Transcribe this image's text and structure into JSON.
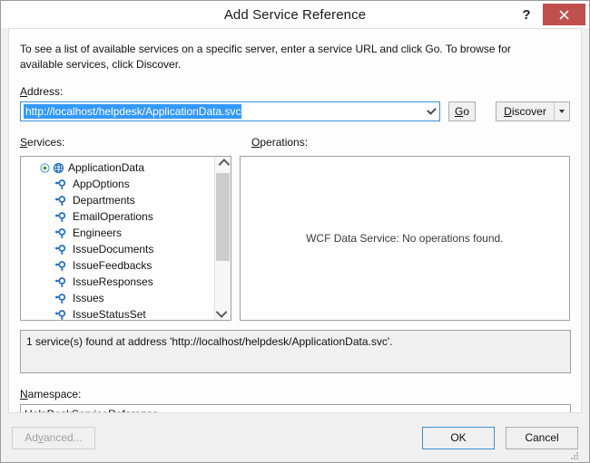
{
  "window": {
    "title": "Add Service Reference",
    "help_label": "?",
    "close_label": "✕"
  },
  "intro": {
    "text": "To see a list of available services on a specific server, enter a service URL and click Go. To browse for available services, click Discover."
  },
  "address": {
    "label_pre": "A",
    "label_post": "ddress:",
    "value": "http://localhost/helpdesk/ApplicationData.svc",
    "placeholder": "",
    "go_pre": "G",
    "go_post": "o",
    "discover_pre": "D",
    "discover_post": "iscover",
    "dropdown_icon": "chevron-down-icon",
    "split_icon": "triangle-down-icon"
  },
  "services": {
    "label_pre": "S",
    "label_post": "ervices:",
    "root": {
      "label": "ApplicationData",
      "icon": "globe-service-icon",
      "expander_icon": "expanded-circle-icon"
    },
    "items": [
      {
        "label": "AppOptions",
        "icon": "interface-icon"
      },
      {
        "label": "Departments",
        "icon": "interface-icon"
      },
      {
        "label": "EmailOperations",
        "icon": "interface-icon"
      },
      {
        "label": "Engineers",
        "icon": "interface-icon"
      },
      {
        "label": "IssueDocuments",
        "icon": "interface-icon"
      },
      {
        "label": "IssueFeedbacks",
        "icon": "interface-icon"
      },
      {
        "label": "IssueResponses",
        "icon": "interface-icon"
      },
      {
        "label": "Issues",
        "icon": "interface-icon"
      },
      {
        "label": "IssueStatusSet",
        "icon": "interface-icon"
      }
    ],
    "scrollbar": {
      "up_icon": "chevron-up-icon",
      "down_icon": "chevron-down-icon"
    }
  },
  "operations": {
    "label_pre": "O",
    "label_post": "perations:",
    "empty_message": "WCF Data Service: No operations found."
  },
  "status": {
    "text": "1 service(s) found at address 'http://localhost/helpdesk/ApplicationData.svc'."
  },
  "namespace": {
    "label_pre": "N",
    "label_post": "amespace:",
    "value": "HelpDeskServiceReference",
    "placeholder": ""
  },
  "footer": {
    "advanced_pre": "Ad",
    "advanced_mid": "v",
    "advanced_post": "anced...",
    "ok_label": "OK",
    "cancel_label": "Cancel",
    "grip_icon": "resize-grip-icon"
  },
  "colors": {
    "close_red": "#c0504d",
    "selection_blue": "#3399ff",
    "focus_border": "#3d8fd4",
    "icon_blue": "#1f6fc4",
    "dialog_bg": "#f0f0f0"
  }
}
